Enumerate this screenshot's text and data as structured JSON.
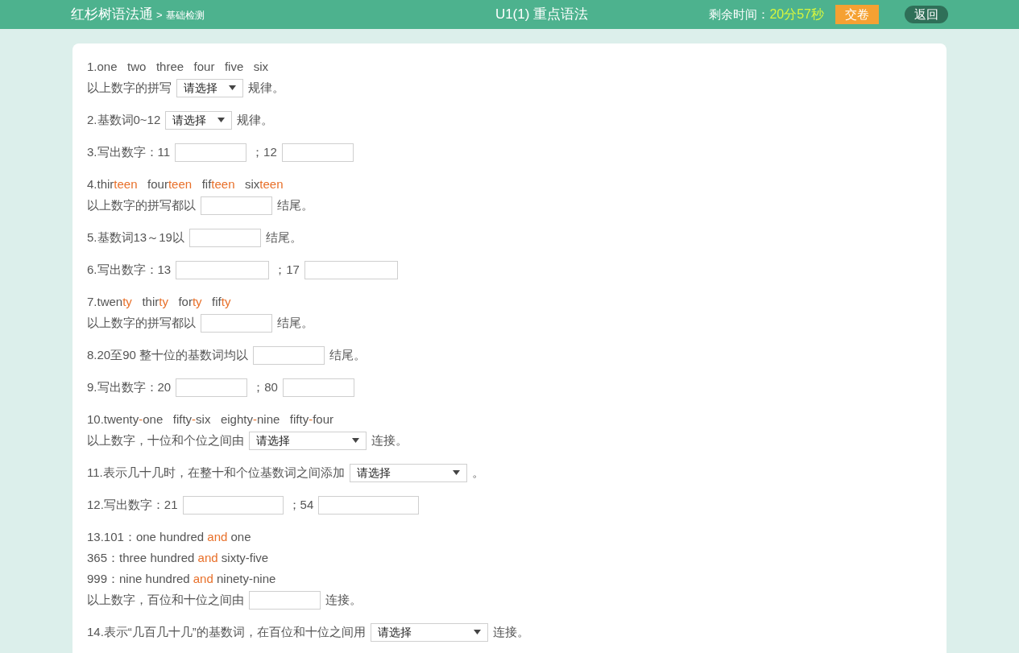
{
  "header": {
    "brand": "红杉树语法通",
    "crumb_separator": ">",
    "crumb": "基础检测",
    "title": "U1(1) 重点语法",
    "timer_label": "剩余时间：",
    "timer_value": "20分57秒",
    "submit": "交卷",
    "back": "返回"
  },
  "questions": [
    {
      "lines": [
        [
          {
            "kind": "text",
            "text": "1.one   two   three   four   five   six"
          }
        ],
        [
          {
            "kind": "text",
            "text": "以上数字的拼写"
          },
          {
            "kind": "select",
            "placeholder": "请选择"
          },
          {
            "kind": "text",
            "text": "规律。"
          }
        ]
      ]
    },
    {
      "lines": [
        [
          {
            "kind": "text",
            "text": "2.基数词0~12"
          },
          {
            "kind": "select",
            "placeholder": "请选择"
          },
          {
            "kind": "text",
            "text": "规律。"
          }
        ]
      ]
    },
    {
      "lines": [
        [
          {
            "kind": "text",
            "text": "3.写出数字：11"
          },
          {
            "kind": "blank"
          },
          {
            "kind": "text",
            "text": "；12"
          },
          {
            "kind": "blank"
          }
        ]
      ]
    },
    {
      "lines": [
        [
          {
            "kind": "text",
            "text": "4.thir"
          },
          {
            "kind": "accent",
            "text": "teen"
          },
          {
            "kind": "text",
            "text": "   four"
          },
          {
            "kind": "accent",
            "text": "teen"
          },
          {
            "kind": "text",
            "text": "   fif"
          },
          {
            "kind": "accent",
            "text": "teen"
          },
          {
            "kind": "text",
            "text": "   six"
          },
          {
            "kind": "accent",
            "text": "teen"
          }
        ],
        [
          {
            "kind": "text",
            "text": "以上数字的拼写都以"
          },
          {
            "kind": "blank"
          },
          {
            "kind": "text",
            "text": "结尾。"
          }
        ]
      ]
    },
    {
      "lines": [
        [
          {
            "kind": "text",
            "text": "5.基数词13～19以"
          },
          {
            "kind": "blank"
          },
          {
            "kind": "text",
            "text": "结尾。"
          }
        ]
      ]
    },
    {
      "lines": [
        [
          {
            "kind": "text",
            "text": "6.写出数字：13"
          },
          {
            "kind": "blankmedium"
          },
          {
            "kind": "text",
            "text": "；17"
          },
          {
            "kind": "blankmedium"
          }
        ]
      ]
    },
    {
      "lines": [
        [
          {
            "kind": "text",
            "text": "7.twen"
          },
          {
            "kind": "accent",
            "text": "ty"
          },
          {
            "kind": "text",
            "text": "   thir"
          },
          {
            "kind": "accent",
            "text": "ty"
          },
          {
            "kind": "text",
            "text": "   for"
          },
          {
            "kind": "accent",
            "text": "ty"
          },
          {
            "kind": "text",
            "text": "   fif"
          },
          {
            "kind": "accent",
            "text": "ty"
          }
        ],
        [
          {
            "kind": "text",
            "text": "以上数字的拼写都以"
          },
          {
            "kind": "blank"
          },
          {
            "kind": "text",
            "text": "结尾。"
          }
        ]
      ]
    },
    {
      "lines": [
        [
          {
            "kind": "text",
            "text": "8.20至90 整十位的基数词均以"
          },
          {
            "kind": "blank"
          },
          {
            "kind": "text",
            "text": "结尾。"
          }
        ]
      ]
    },
    {
      "lines": [
        [
          {
            "kind": "text",
            "text": "9.写出数字：20"
          },
          {
            "kind": "blank"
          },
          {
            "kind": "text",
            "text": "；80"
          },
          {
            "kind": "blank"
          }
        ]
      ]
    },
    {
      "lines": [
        [
          {
            "kind": "text",
            "text": "10.twenty"
          },
          {
            "kind": "accent",
            "text": "-"
          },
          {
            "kind": "text",
            "text": "one   fifty"
          },
          {
            "kind": "accent",
            "text": "-"
          },
          {
            "kind": "text",
            "text": "six   eighty"
          },
          {
            "kind": "accent",
            "text": "-"
          },
          {
            "kind": "text",
            "text": "nine   fifty"
          },
          {
            "kind": "accent",
            "text": "-"
          },
          {
            "kind": "text",
            "text": "four"
          }
        ],
        [
          {
            "kind": "text",
            "text": "以上数字，十位和个位之间由"
          },
          {
            "kind": "selectwide",
            "placeholder": "请选择"
          },
          {
            "kind": "text",
            "text": "连接。"
          }
        ]
      ]
    },
    {
      "lines": [
        [
          {
            "kind": "text",
            "text": "11.表示几十几时，在整十和个位基数词之间添加"
          },
          {
            "kind": "selectwide",
            "placeholder": "请选择"
          },
          {
            "kind": "text",
            "text": "。"
          }
        ]
      ]
    },
    {
      "lines": [
        [
          {
            "kind": "text",
            "text": "12.写出数字：21"
          },
          {
            "kind": "blankwide"
          },
          {
            "kind": "text",
            "text": "；54"
          },
          {
            "kind": "blankwide"
          }
        ]
      ]
    },
    {
      "lines": [
        [
          {
            "kind": "text",
            "text": "13.101：one hundred "
          },
          {
            "kind": "accent",
            "text": "and"
          },
          {
            "kind": "text",
            "text": " one"
          }
        ],
        [
          {
            "kind": "text",
            "text": "365：three hundred "
          },
          {
            "kind": "accent",
            "text": "and"
          },
          {
            "kind": "text",
            "text": " sixty-five"
          }
        ],
        [
          {
            "kind": "text",
            "text": "999：nine hundred "
          },
          {
            "kind": "accent",
            "text": "and"
          },
          {
            "kind": "text",
            "text": " ninety-nine"
          }
        ],
        [
          {
            "kind": "text",
            "text": "以上数字，百位和十位之间由"
          },
          {
            "kind": "blank"
          },
          {
            "kind": "text",
            "text": "连接。"
          }
        ]
      ]
    },
    {
      "lines": [
        [
          {
            "kind": "text",
            "text": "14.表示“几百几十几”的基数词，在百位和十位之间用"
          },
          {
            "kind": "selectwide",
            "placeholder": "请选择"
          },
          {
            "kind": "text",
            "text": "连接。"
          }
        ]
      ]
    }
  ]
}
